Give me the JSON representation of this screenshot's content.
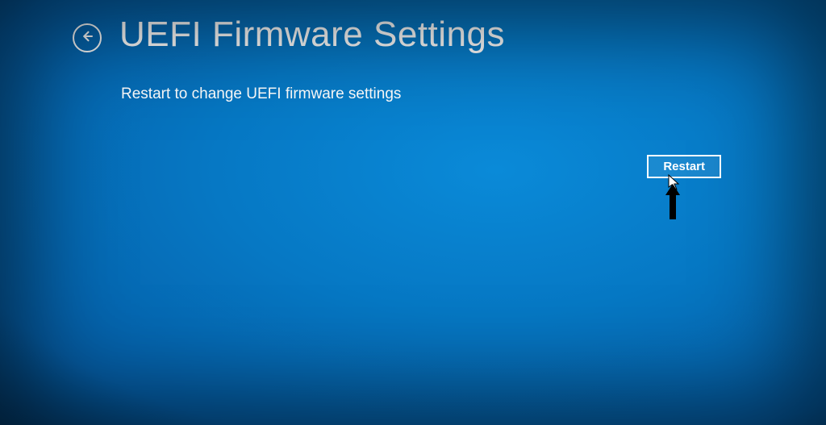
{
  "header": {
    "title": "UEFI Firmware Settings"
  },
  "body": {
    "subtitle": "Restart to change UEFI firmware settings"
  },
  "actions": {
    "restart_label": "Restart"
  }
}
